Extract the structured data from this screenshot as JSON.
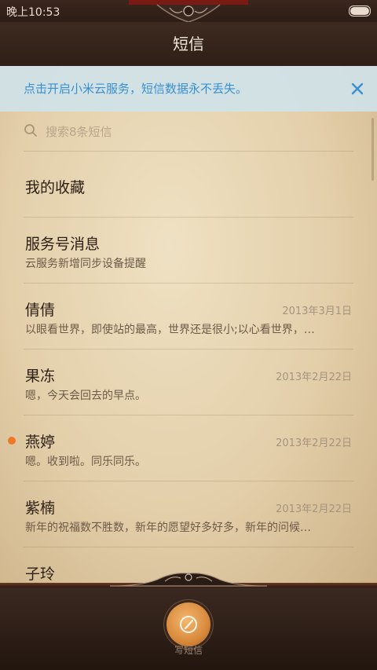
{
  "status_bar": {
    "time": "晚上10:53"
  },
  "app": {
    "title": "短信"
  },
  "cloud_banner": {
    "text": "点击开启小米云服务，短信数据永不丢失。"
  },
  "search": {
    "placeholder": "搜索8条短信"
  },
  "conversations": [
    {
      "name": "我的收藏",
      "preview": "",
      "date": "",
      "unread": false
    },
    {
      "name": "服务号消息",
      "preview": "云服务新增同步设备提醒",
      "date": "",
      "unread": false
    },
    {
      "name": "倩倩",
      "preview": "以眼看世界，即使站的最高，世界还是很小;以心看世界，…",
      "date": "2013年3月1日",
      "unread": false
    },
    {
      "name": "果冻",
      "preview": "嗯，今天会回去的早点。",
      "date": "2013年2月22日",
      "unread": false
    },
    {
      "name": "燕婷",
      "preview": "嗯。收到啦。同乐同乐。",
      "date": "2013年2月22日",
      "unread": true
    },
    {
      "name": "紫楠",
      "preview": "新年的祝福数不胜数，新年的愿望好多好多，新年的问候…",
      "date": "2013年2月22日",
      "unread": false
    },
    {
      "name": "子玲",
      "preview": "",
      "date": "",
      "unread": false
    }
  ],
  "bottom_bar": {
    "compose_label": "写短信"
  },
  "colors": {
    "accent_blue": "#3a8fd2",
    "unread_dot": "#f0762a",
    "compose_button": "#d88a3b"
  }
}
